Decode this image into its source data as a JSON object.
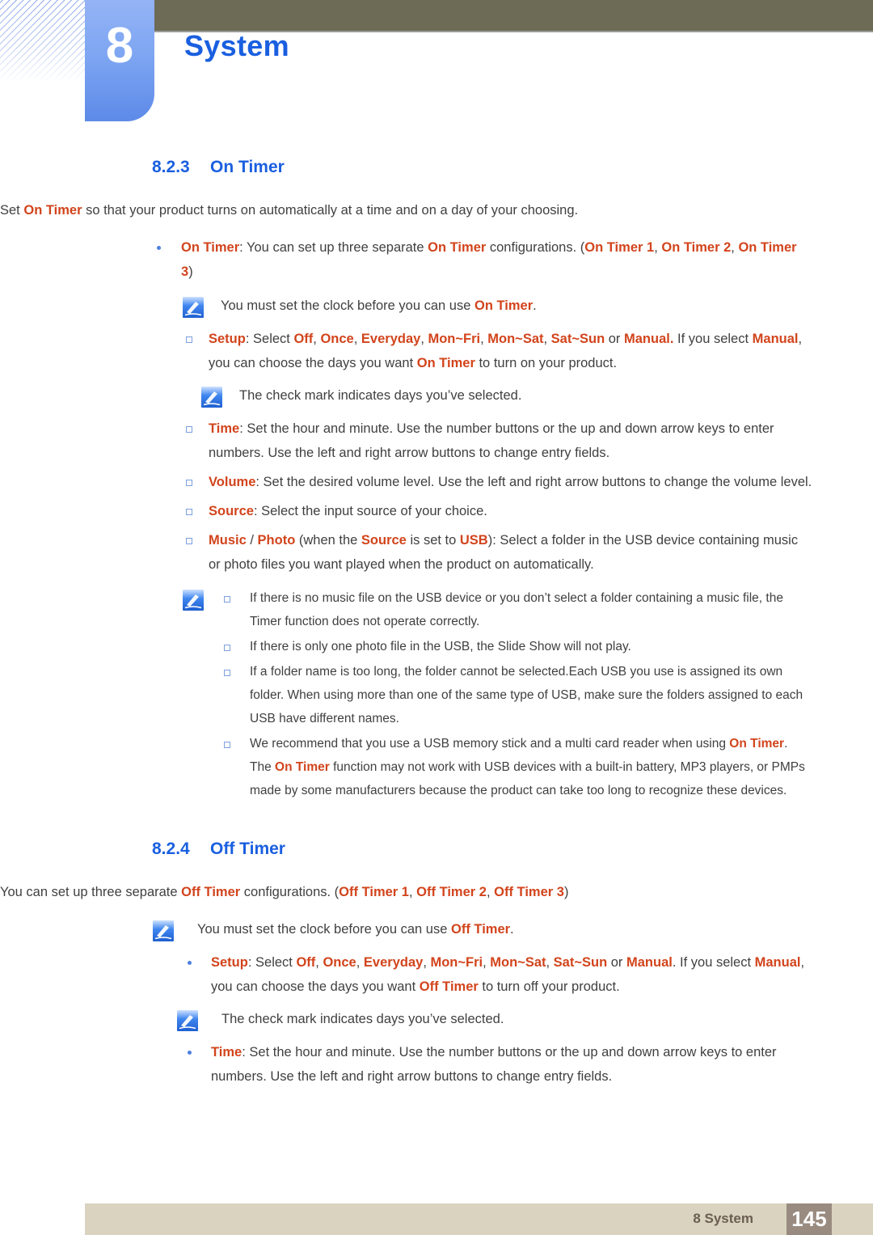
{
  "header": {
    "chapter_number": "8",
    "chapter_title": "System"
  },
  "sections": [
    {
      "number": "8.2.3",
      "title": "On Timer",
      "intro_plain": "Set On Timer so that your product turns on automatically at a time and on a day of your choosing.",
      "bullet1_plain": "On Timer: You can set up three separate On Timer configurations. (On Timer 1, On Timer 2, On Timer 3)",
      "note1_plain": "You must set the clock before you can use On Timer.",
      "setup_plain": "Setup: Select Off, Once, Everyday, Mon~Fri, Mon~Sat, Sat~Sun or Manual. If you select Manual, you can choose the days you want On Timer to turn on your product.",
      "note2_plain": "The check mark indicates days you’ve selected.",
      "time_plain": "Time: Set the hour and minute. Use the number buttons or the up and down arrow keys to enter numbers. Use the left and right arrow buttons to change entry fields.",
      "volume_plain": "Volume: Set the desired volume level. Use the left and right arrow buttons to change the volume level.",
      "source_plain": "Source: Select the input source of your choice.",
      "music_plain": "Music / Photo (when the Source is set to USB): Select a folder in the USB device containing music or photo files you want played when the product on automatically.",
      "note3_items_plain": [
        "If there is no music file on the USB device or you don’t select a folder containing a music file, the Timer function does not operate correctly.",
        "If there is only one photo file in the USB, the Slide Show will not play.",
        "If a folder name is too long, the folder cannot be selected.Each USB you use is assigned its own folder. When using more than one of the same type of USB, make sure the folders assigned to each USB have different names.",
        "We recommend that you use a USB memory stick and a multi card reader when using On Timer. The On Timer function may not work with USB devices with a built-in battery, MP3 players, or PMPs made by some manufacturers because the product can take too long to recognize these devices."
      ]
    },
    {
      "number": "8.2.4",
      "title": "Off Timer",
      "intro_plain": "You can set up three separate Off Timer configurations. (Off Timer 1, Off Timer 2, Off Timer 3)",
      "note1_plain": "You must set the clock before you can use Off Timer.",
      "setup_plain": "Setup: Select Off, Once, Everyday, Mon~Fri, Mon~Sat, Sat~Sun or Manual. If you select Manual, you can choose the days you want Off Timer to turn off your product.",
      "note2_plain": "The check mark indicates days you’ve selected.",
      "time_plain": "Time: Set the hour and minute. Use the number buttons or the up and down arrow keys to enter numbers. Use the left and right arrow buttons to change entry fields."
    }
  ],
  "footer": {
    "label": "8 System",
    "page_number": "145"
  },
  "colors": {
    "heading_blue": "#1a5fe0",
    "keyword_orange": "#d2441c",
    "body_gray": "#404040",
    "topbar_olive": "#6d6b55",
    "tab_blue": "#7ea6f2",
    "footer_beige": "#d9d3bf",
    "footer_page_brown": "#9a8b80"
  },
  "icons": {
    "note": "note-pencil-icon"
  }
}
